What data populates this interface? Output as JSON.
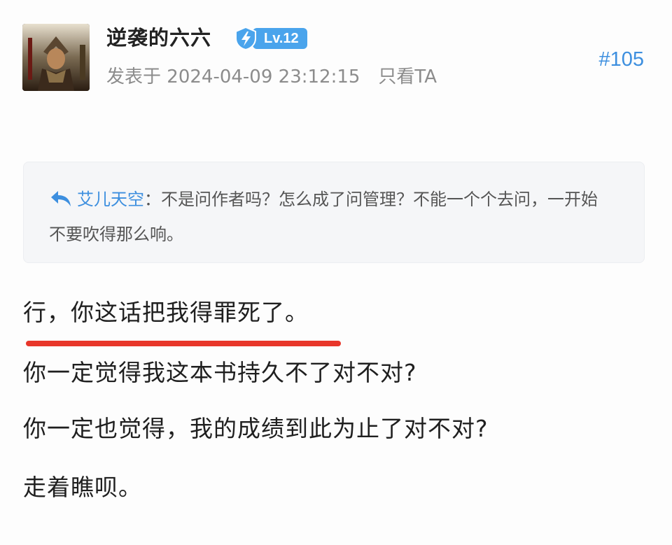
{
  "post": {
    "username": "逆袭的六六",
    "level": "Lv.12",
    "posted_prefix": "发表于",
    "posted_time": "2024-04-09 23:12:15",
    "only_view": "只看TA",
    "floor": "#105"
  },
  "quote": {
    "user": "艾儿天空",
    "separator": "：",
    "text": "不是问作者吗？怎么成了问管理？不能一个个去问，一开始不要吹得那么响。"
  },
  "content": {
    "lines": [
      "行，你这话把我得罪死了。",
      "你一定觉得我这本书持久不了对不对?",
      "你一定也觉得，我的成绩到此为止了对不对?",
      "走着瞧呗。"
    ]
  },
  "colors": {
    "accent_blue": "#3d8fdf",
    "badge_blue": "#4aa4ec",
    "underline_red": "#e8362a",
    "muted_gray": "#8c8c8c"
  },
  "icons": {
    "avatar": "avatar",
    "level": "level-shield-icon",
    "reply": "reply-arrow-icon"
  }
}
